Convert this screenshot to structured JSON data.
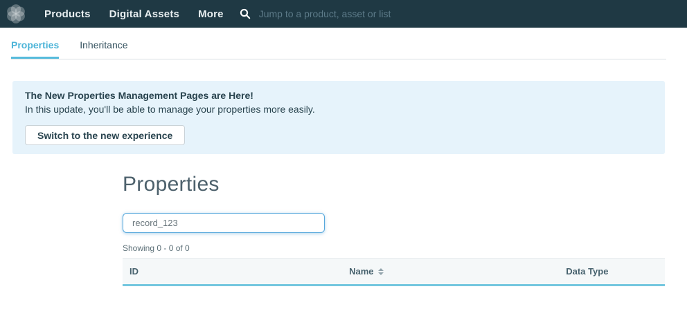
{
  "navbar": {
    "items": [
      {
        "label": "Products"
      },
      {
        "label": "Digital Assets"
      },
      {
        "label": "More"
      }
    ],
    "search_placeholder": "Jump to a product, asset or list"
  },
  "tabs": [
    {
      "label": "Properties",
      "active": true
    },
    {
      "label": "Inheritance",
      "active": false
    }
  ],
  "banner": {
    "title": "The New Properties Management Pages are Here!",
    "body": "In this update, you'll be able to manage your properties more easily.",
    "button_label": "Switch to the new experience"
  },
  "main": {
    "heading": "Properties",
    "filter_value": "record_123",
    "results_summary": "Showing 0 - 0 of 0",
    "table": {
      "columns": [
        {
          "label": "ID",
          "sortable": false
        },
        {
          "label": "Name",
          "sortable": true
        },
        {
          "label": "Data Type",
          "sortable": false
        }
      ],
      "rows": []
    }
  },
  "colors": {
    "navbar_bg": "#1f3944",
    "active_tab": "#4cb4d8",
    "tab_underline": "#56bbdc",
    "banner_bg": "#e6f3fb",
    "table_accent": "#74c7df",
    "input_focus_border": "#57a8dc"
  }
}
